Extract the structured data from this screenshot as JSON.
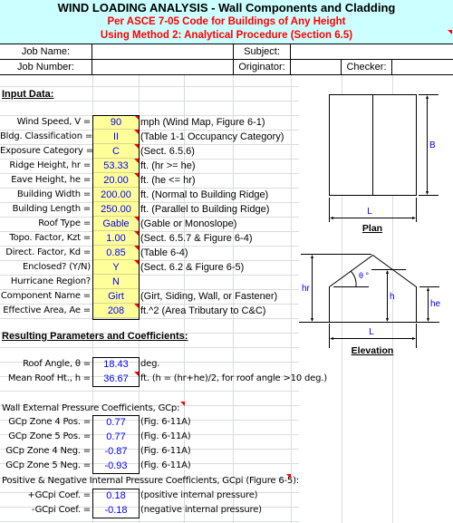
{
  "header": {
    "title": "WIND LOADING ANALYSIS - Wall Components and Cladding",
    "subtitle1": "Per ASCE 7-05 Code for Buildings of Any Height",
    "subtitle2": "Using Method 2: Analytical Procedure (Section 6.5)"
  },
  "job": {
    "job_name_label": "Job Name:",
    "job_number_label": "Job Number:",
    "subject_label": "Subject:",
    "originator_label": "Originator:",
    "checker_label": "Checker:",
    "job_name": "",
    "job_number": "",
    "subject": "",
    "originator": "",
    "checker": ""
  },
  "input": {
    "heading": "Input Data:",
    "rows": [
      {
        "label": "Wind Speed, V =",
        "value": "90",
        "note": "mph  (Wind Map, Figure 6-1)",
        "comment": true
      },
      {
        "label": "Bldg. Classification =",
        "value": "II",
        "note": "(Table 1-1 Occupancy Category)",
        "comment": true
      },
      {
        "label": "Exposure Category =",
        "value": "C",
        "note": "(Sect. 6.5.6)",
        "comment": true
      },
      {
        "label": "Ridge Height, hr =",
        "value": "53.33",
        "note": "ft. (hr >= he)",
        "comment": true
      },
      {
        "label": "Eave Height, he =",
        "value": "20.00",
        "note": "ft. (he <= hr)",
        "comment": true
      },
      {
        "label": "Building Width =",
        "value": "200.00",
        "note": "ft. (Normal to Building Ridge)",
        "comment": false
      },
      {
        "label": "Building Length =",
        "value": "250.00",
        "note": "ft. (Parallel to Building Ridge)",
        "comment": false
      },
      {
        "label": "Roof Type =",
        "value": "Gable",
        "note": "(Gable or Monoslope)",
        "comment": true
      },
      {
        "label": "Topo. Factor, Kzt =",
        "value": "1.00",
        "note": "(Sect. 6.5.7 & Figure 6-4)",
        "comment": true
      },
      {
        "label": "Direct. Factor, Kd =",
        "value": "0.85",
        "note": "(Table 6-4)",
        "comment": true
      },
      {
        "label": "Enclosed? (Y/N)",
        "value": "Y",
        "note": "(Sect. 6.2 & Figure 6-5)",
        "comment": true
      },
      {
        "label": "Hurricane Region?",
        "value": "N",
        "note": "",
        "comment": false
      },
      {
        "label": "Component Name =",
        "value": "Girt",
        "note": "(Girt, Siding, Wall, or Fastener)",
        "comment": false
      },
      {
        "label": "Effective Area, Ae =",
        "value": "208",
        "note": "ft.^2  (Area Tributary to C&C)",
        "comment": true
      }
    ]
  },
  "results": {
    "heading": "Resulting Parameters and Coefficients:",
    "rows": [
      {
        "label": "Roof Angle, θ =",
        "value": "18.43",
        "note": "deg."
      },
      {
        "label": "Mean Roof  Ht., h =",
        "value": "36.67",
        "note": "ft. (h = (hr+he)/2, for roof angle >10 deg.)"
      }
    ],
    "gcp_heading": "Wall External Pressure Coefficients, GCp:",
    "gcp_rows": [
      {
        "label": "GCp Zone 4 Pos. =",
        "value": "0.77",
        "note": "(Fig. 6-11A)"
      },
      {
        "label": "GCp Zone 5 Pos. =",
        "value": "0.77",
        "note": "(Fig. 6-11A)"
      },
      {
        "label": "GCp Zone 4 Neg. =",
        "value": "-0.87",
        "note": "(Fig. 6-11A)"
      },
      {
        "label": "GCp Zone 5 Neg. =",
        "value": "-0.93",
        "note": "(Fig. 6-11A)"
      }
    ],
    "gcpi_heading": "Positive & Negative Internal Pressure Coefficients, GCpi (Figure 6-5):",
    "gcpi_rows": [
      {
        "label": "+GCpi Coef. =",
        "value": "0.18",
        "note": "(positive internal pressure)"
      },
      {
        "label": "-GCpi Coef. =",
        "value": "-0.18",
        "note": "(negative internal pressure)"
      }
    ]
  },
  "diagrams": {
    "plan": {
      "caption": "Plan",
      "dim_b": "B",
      "dim_l": "L"
    },
    "elevation": {
      "caption": "Elevation",
      "dim_hr": "hr",
      "dim_h": "h",
      "dim_he": "he",
      "dim_l": "L",
      "angle": "θ °"
    }
  },
  "colors": {
    "header_bg": "#ccffff",
    "header_red": "#ff0000",
    "input_bg": "#ffff99",
    "value_blue": "#0000ff"
  }
}
